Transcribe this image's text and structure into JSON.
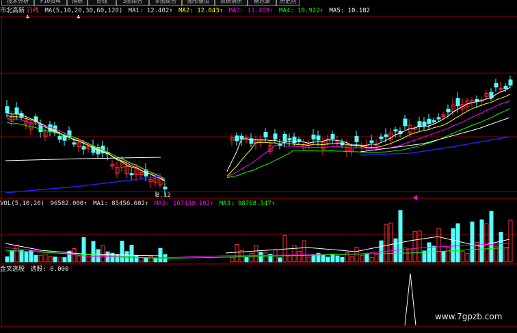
{
  "toolbar": {
    "buttons": [
      "技术分析",
      "F10资料",
      "指标",
      "日线",
      "3图组合",
      "多图组合",
      "图形叠加",
      "系统指示",
      "备忘录",
      "历史回"
    ]
  },
  "price_panel": {
    "name": "市北高新",
    "period": "日线",
    "ma_params": "MA(5,10,20,30,60,120)",
    "ma1": "MA1: 12.402↑",
    "ma2": "MA2: 12.043↑",
    "ma3": "MA3: 11.469↑",
    "ma4": "MA4: 10.922↑",
    "ma5": "MA5: 10.182",
    "low_label": "8.12"
  },
  "volume_panel": {
    "params": "VOL(5,10,20)",
    "vol": "96582.000↑",
    "ma1": "MA1: 85456.602↑",
    "ma2": "MA2: 107430.102↑",
    "ma3": "MA3: 98768.547↑"
  },
  "signal_panel": {
    "title": "金叉选股",
    "value": "选股: 0.000"
  },
  "watermark": "www.7gpzb.com",
  "colors": {
    "up": "#ff3030",
    "down": "#54ffff",
    "ma_white": "#ffffff",
    "ma_yellow": "#ffff00",
    "ma_magenta": "#ff00ff",
    "ma_green": "#00ff00",
    "ma_blue": "#2020ff",
    "grid": "#8b0000"
  }
}
